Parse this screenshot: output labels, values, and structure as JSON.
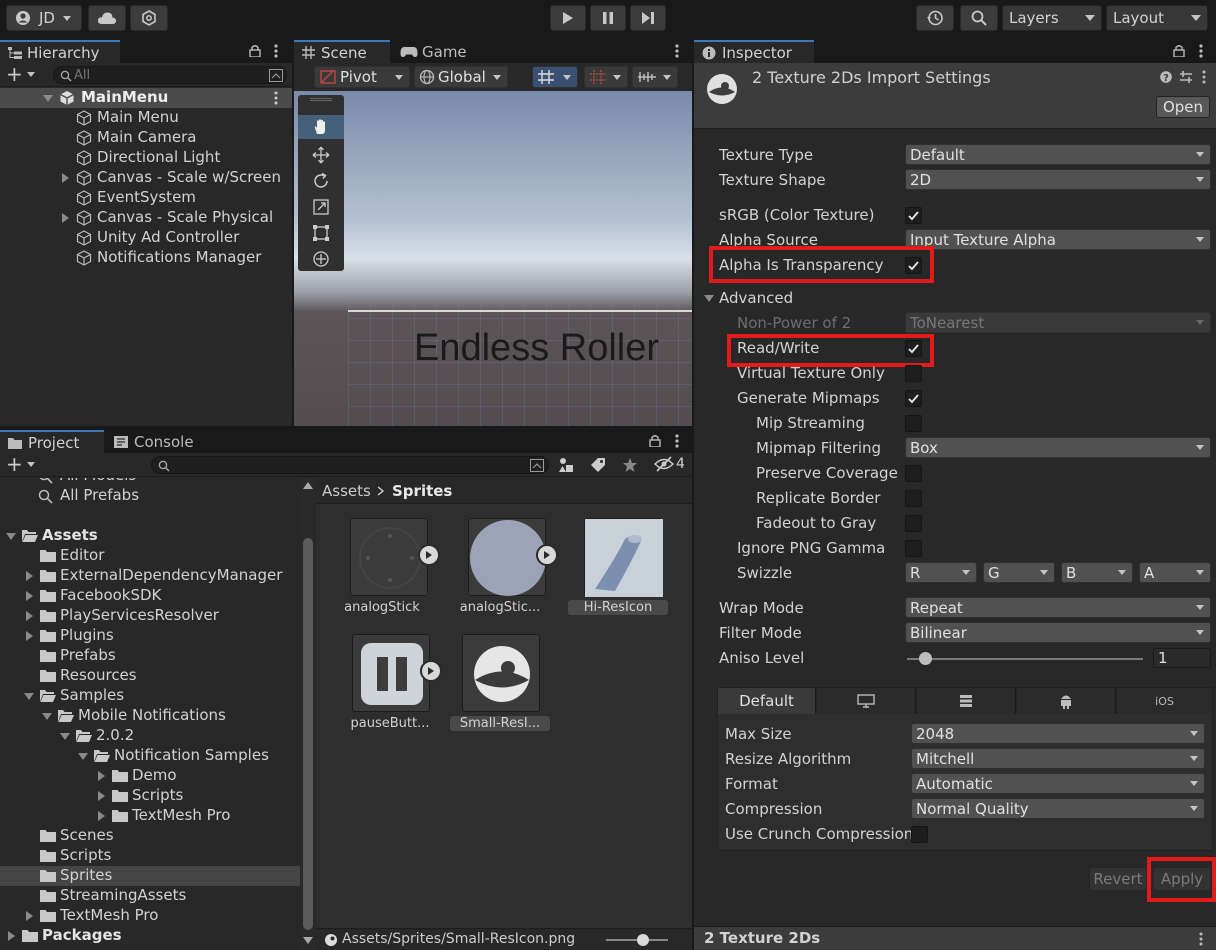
{
  "toolbar": {
    "account": "JD",
    "layers": "Layers",
    "layout": "Layout"
  },
  "hierarchy": {
    "tab": "Hierarchy",
    "search_placeholder": "All",
    "scene": "MainMenu",
    "items": [
      {
        "label": "Main Menu",
        "expandable": false
      },
      {
        "label": "Main Camera",
        "expandable": false
      },
      {
        "label": "Directional Light",
        "expandable": false
      },
      {
        "label": "Canvas - Scale w/Screen",
        "expandable": true
      },
      {
        "label": "EventSystem",
        "expandable": false
      },
      {
        "label": "Canvas - Scale Physical",
        "expandable": true
      },
      {
        "label": "Unity Ad Controller",
        "expandable": false
      },
      {
        "label": "Notifications Manager",
        "expandable": false
      }
    ]
  },
  "scene": {
    "tab_scene": "Scene",
    "tab_game": "Game",
    "pivot": "Pivot",
    "global": "Global",
    "title_text": "Endless Roller"
  },
  "project": {
    "tab_project": "Project",
    "tab_console": "Console",
    "hidden_count": "4",
    "favorites": [
      "All Models",
      "All Prefabs"
    ],
    "tree": [
      {
        "label": "Assets",
        "level": 0,
        "open": true,
        "bold": true
      },
      {
        "label": "Editor",
        "level": 1,
        "open": false,
        "arrow": false
      },
      {
        "label": "ExternalDependencyManager",
        "level": 1,
        "arrow": true
      },
      {
        "label": "FacebookSDK",
        "level": 1,
        "arrow": true
      },
      {
        "label": "PlayServicesResolver",
        "level": 1,
        "arrow": true
      },
      {
        "label": "Plugins",
        "level": 1,
        "arrow": true
      },
      {
        "label": "Prefabs",
        "level": 1,
        "arrow": false
      },
      {
        "label": "Resources",
        "level": 1,
        "arrow": false
      },
      {
        "label": "Samples",
        "level": 1,
        "open": true
      },
      {
        "label": "Mobile Notifications",
        "level": 2,
        "open": true
      },
      {
        "label": "2.0.2",
        "level": 3,
        "open": true
      },
      {
        "label": "Notification Samples",
        "level": 4,
        "open": true
      },
      {
        "label": "Demo",
        "level": 5,
        "arrow": true
      },
      {
        "label": "Scripts",
        "level": 5,
        "arrow": true
      },
      {
        "label": "TextMesh Pro",
        "level": 5,
        "arrow": true
      },
      {
        "label": "Scenes",
        "level": 1,
        "arrow": false
      },
      {
        "label": "Scripts",
        "level": 1,
        "arrow": false
      },
      {
        "label": "Sprites",
        "level": 1,
        "arrow": false,
        "selected": true
      },
      {
        "label": "StreamingAssets",
        "level": 1,
        "arrow": false
      },
      {
        "label": "TextMesh Pro",
        "level": 1,
        "arrow": true
      },
      {
        "label": "Packages",
        "level": 0,
        "arrow": true,
        "bold": true
      }
    ],
    "breadcrumb_root": "Assets",
    "breadcrumb_current": "Sprites",
    "assets": [
      {
        "label": "analogStick"
      },
      {
        "label": "analogStic..."
      },
      {
        "label": "Hi-ResIcon"
      },
      {
        "label": "pauseButt..."
      },
      {
        "label": "Small-ResI..."
      }
    ],
    "status_path": "Assets/Sprites/Small-ResIcon.png"
  },
  "inspector": {
    "tab": "Inspector",
    "title": "2 Texture 2Ds Import Settings",
    "open_button": "Open",
    "texture_type_label": "Texture Type",
    "texture_type_value": "Default",
    "texture_shape_label": "Texture Shape",
    "texture_shape_value": "2D",
    "srgb_label": "sRGB (Color Texture)",
    "alpha_source_label": "Alpha Source",
    "alpha_source_value": "Input Texture Alpha",
    "alpha_transparency_label": "Alpha Is Transparency",
    "advanced_label": "Advanced",
    "npot_label": "Non-Power of 2",
    "npot_value": "ToNearest",
    "readwrite_label": "Read/Write",
    "virtual_texture_label": "Virtual Texture Only",
    "gen_mipmaps_label": "Generate Mipmaps",
    "mip_streaming_label": "Mip Streaming",
    "mipmap_filtering_label": "Mipmap Filtering",
    "mipmap_filtering_value": "Box",
    "preserve_coverage_label": "Preserve Coverage",
    "replicate_border_label": "Replicate Border",
    "fadeout_label": "Fadeout to Gray",
    "ignore_png_gamma_label": "Ignore PNG Gamma",
    "swizzle_label": "Swizzle",
    "swizzle": [
      "R",
      "G",
      "B",
      "A"
    ],
    "wrap_mode_label": "Wrap Mode",
    "wrap_mode_value": "Repeat",
    "filter_mode_label": "Filter Mode",
    "filter_mode_value": "Bilinear",
    "aniso_label": "Aniso Level",
    "aniso_value": "1",
    "platform_default_tab": "Default",
    "platform_ios_tab": "iOS",
    "max_size_label": "Max Size",
    "max_size_value": "2048",
    "resize_label": "Resize Algorithm",
    "resize_value": "Mitchell",
    "format_label": "Format",
    "format_value": "Automatic",
    "compression_label": "Compression",
    "compression_value": "Normal Quality",
    "crunch_label": "Use Crunch Compression",
    "revert_button": "Revert",
    "apply_button": "Apply",
    "footer": "2 Texture 2Ds"
  },
  "colors": {
    "highlight": "#e21a1a",
    "selection": "#3e5f96",
    "tab_accent": "#3a79bb"
  }
}
